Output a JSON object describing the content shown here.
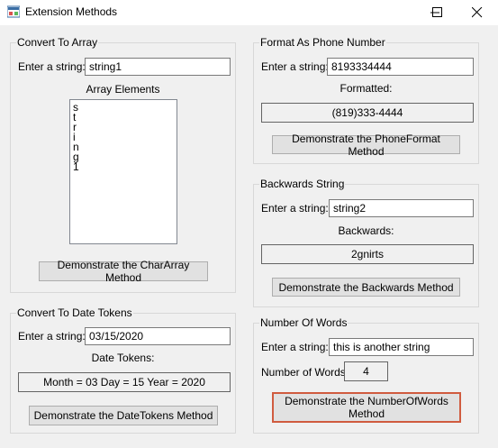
{
  "window": {
    "title": "Extension Methods",
    "controls": [
      "minimize-icon",
      "maximize-icon",
      "close-icon"
    ]
  },
  "array_group": {
    "title": "Convert To Array",
    "input_label": "Enter a string:",
    "input_value": "string1",
    "list_label": "Array Elements",
    "list_items": [
      "s",
      "t",
      "r",
      "i",
      "n",
      "g",
      "1"
    ],
    "button_label": "Demonstrate the CharArray Method"
  },
  "date_group": {
    "title": "Convert To Date Tokens",
    "input_label": "Enter a string:",
    "input_value": "03/15/2020",
    "output_label": "Date Tokens:",
    "output_value": "Month = 03 Day = 15 Year = 2020",
    "button_label": "Demonstrate the DateTokens Method"
  },
  "phone_group": {
    "title": "Format As Phone Number",
    "input_label": "Enter a string:",
    "input_value": "8193334444",
    "output_label": "Formatted:",
    "output_value": "(819)333-4444",
    "button_label": "Demonstrate the PhoneFormat Method"
  },
  "backwards_group": {
    "title": "Backwards String",
    "input_label": "Enter a string:",
    "input_value": "string2",
    "output_label": "Backwards:",
    "output_value": "2gnirts",
    "button_label": "Demonstrate the Backwards Method"
  },
  "words_group": {
    "title": "Number Of Words",
    "input_label": "Enter a string:",
    "input_value": "this is another string",
    "output_label": "Number of Words:",
    "output_value": "4",
    "button_label": "Demonstrate the NumberOfWords Method"
  }
}
